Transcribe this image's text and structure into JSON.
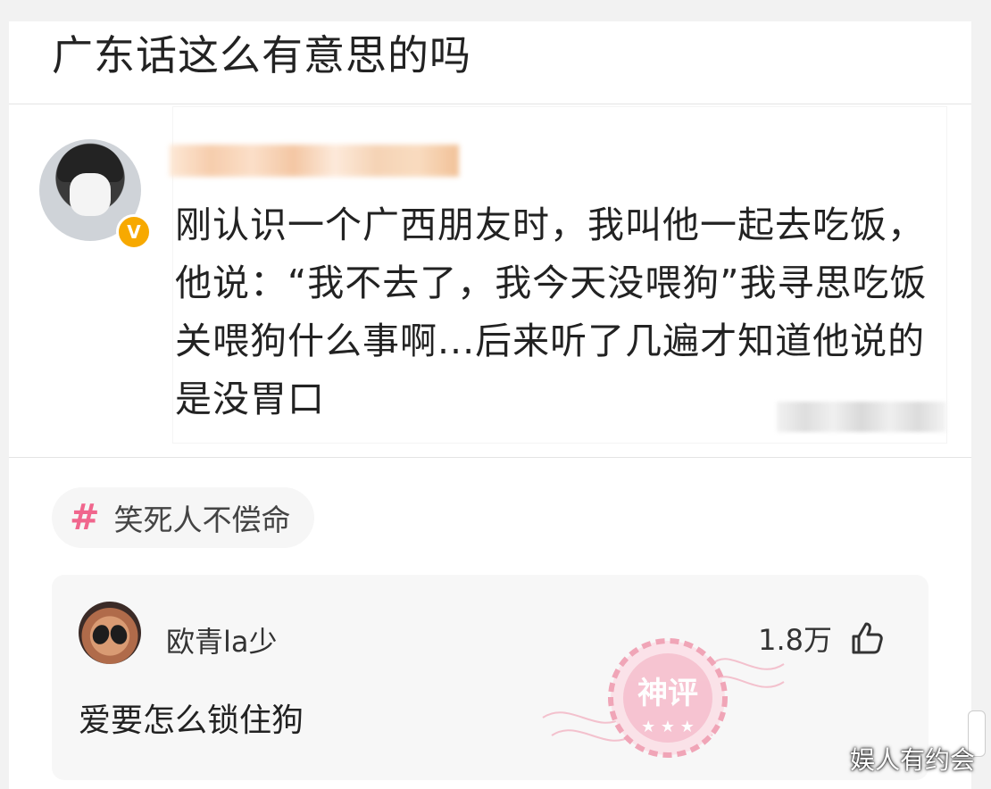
{
  "post": {
    "title": "广东话这么有意思的吗",
    "content": "刚认识一个广西朋友时，我叫他一起去吃饭，他说：“我不去了，我今天没喂狗”我寻思吃饭关喂狗什么事啊...后来听了几遍才知道他说的是没胃口",
    "verified_badge": "V"
  },
  "topic": {
    "hash": "#",
    "label": "笑死人不偿命"
  },
  "comment": {
    "username": "欧青la少",
    "likes": "1.8万",
    "text": "爱要怎么锁住狗",
    "stamp_label": "神评"
  },
  "watermark": "娱人有约会",
  "icons": [
    "verified-badge-icon",
    "hashtag-icon",
    "thumbs-up-icon",
    "stamp-icon"
  ],
  "colors": {
    "accent_pink": "#f0668d",
    "badge_orange": "#f7a900",
    "stamp_pink": "#f0a1b4"
  }
}
